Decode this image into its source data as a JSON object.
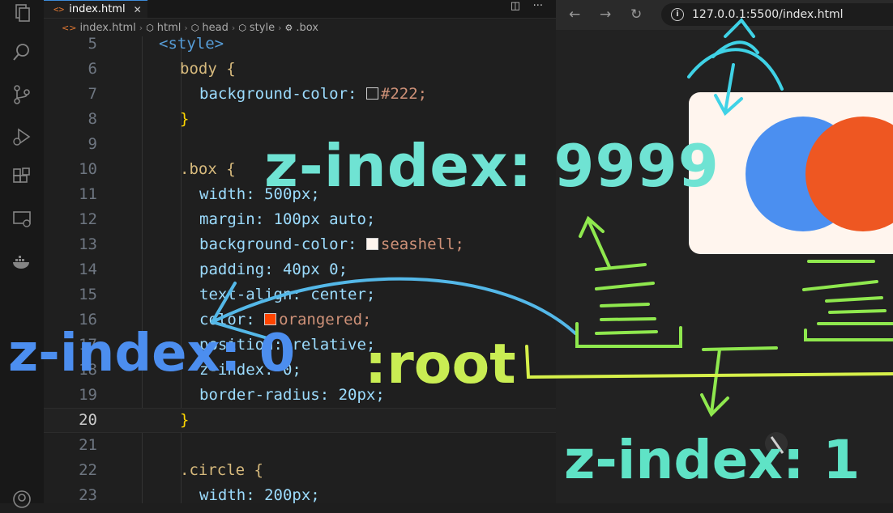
{
  "tab": {
    "icon": "<>",
    "label": "index.html",
    "close": "✕"
  },
  "tab_actions": {
    "split": "◫",
    "more": "···"
  },
  "breadcrumb": {
    "items": [
      {
        "icon": "<>",
        "label": "index.html"
      },
      {
        "icon": "⬡",
        "label": "html"
      },
      {
        "icon": "⬡",
        "label": "head"
      },
      {
        "icon": "⬡",
        "label": "style"
      },
      {
        "icon": "⚙",
        "label": ".box"
      }
    ]
  },
  "editor": {
    "current_line": "20",
    "lines": [
      {
        "n": "5",
        "text": "<style>"
      },
      {
        "n": "6",
        "text": "body {"
      },
      {
        "n": "7",
        "text": "background-color: #222;"
      },
      {
        "n": "8",
        "text": "}"
      },
      {
        "n": "9",
        "text": ""
      },
      {
        "n": "10",
        "text": ".box {"
      },
      {
        "n": "11",
        "text": "width: 500px;"
      },
      {
        "n": "12",
        "text": "margin: 100px auto;"
      },
      {
        "n": "13",
        "text": "background-color: seashell;"
      },
      {
        "n": "14",
        "text": "padding: 40px 0;"
      },
      {
        "n": "15",
        "text": "text-align: center;"
      },
      {
        "n": "16",
        "text": "color: orangered;"
      },
      {
        "n": "17",
        "text": "position: relative;"
      },
      {
        "n": "18",
        "text": "z-index: 0;"
      },
      {
        "n": "19",
        "text": "border-radius: 20px;"
      },
      {
        "n": "20",
        "text": "}"
      },
      {
        "n": "21",
        "text": ""
      },
      {
        "n": "22",
        "text": ".circle {"
      },
      {
        "n": "23",
        "text": "width: 200px;"
      }
    ]
  },
  "colors": {
    "swatch_body": "#222222",
    "swatch_seashell": "#fff5ee",
    "swatch_orangered": "#ff4500"
  },
  "browser": {
    "nav": {
      "back": "←",
      "forward": "→",
      "reload": "↻"
    },
    "info_icon": "i",
    "url": "127.0.0.1:5500/index.html"
  },
  "annotations": {
    "z9999": "z-index: 9999",
    "z0": "z-index: 0",
    "root": ":root",
    "z1": "z-index: 1"
  }
}
